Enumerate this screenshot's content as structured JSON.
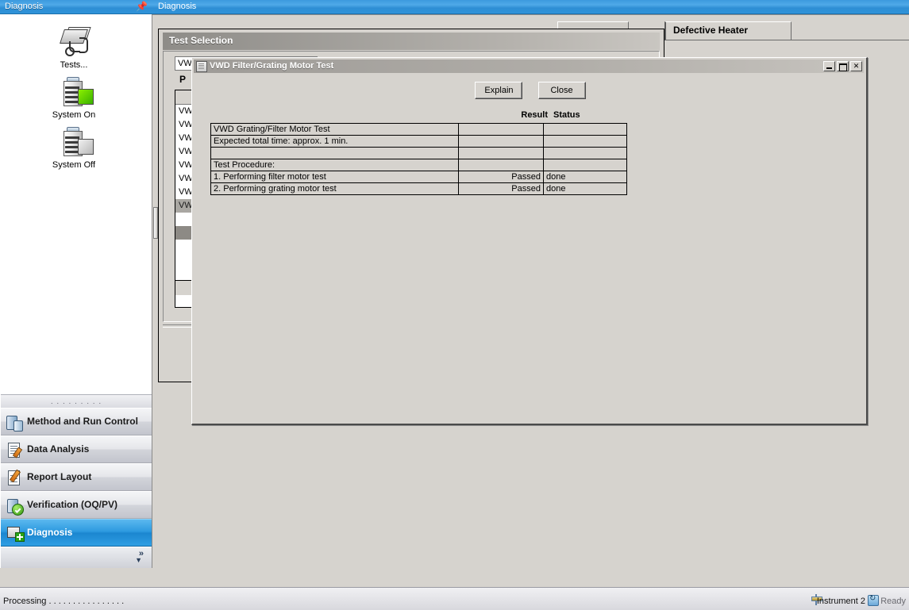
{
  "nav_panel": {
    "title": "Diagnosis",
    "pin_icon": "pin-icon",
    "icons": [
      {
        "label": "Tests...",
        "icon": "tests-instrument-icon"
      },
      {
        "label": "System On",
        "icon": "system-on-icon"
      },
      {
        "label": "System Off",
        "icon": "system-off-icon"
      }
    ],
    "dots": ". . . . . . . . .",
    "buttons": [
      {
        "label": "Method and Run Control",
        "icon": "method-run-control-icon",
        "selected": false
      },
      {
        "label": "Data Analysis",
        "icon": "data-analysis-icon",
        "selected": false
      },
      {
        "label": "Report Layout",
        "icon": "report-layout-icon",
        "selected": false
      },
      {
        "label": "Verification (OQ/PV)",
        "icon": "verification-icon",
        "selected": false
      },
      {
        "label": "Diagnosis",
        "icon": "diagnosis-icon",
        "selected": true
      }
    ],
    "expand_icon": "»",
    "expand_icon_2": "▼"
  },
  "workspace": {
    "title": "Diagnosis",
    "tabs": [
      {
        "label": "Defective Heater",
        "active": true
      },
      {
        "label": "",
        "active": false
      }
    ],
    "test_selection": {
      "caption": "Test Selection",
      "column_header": "VW",
      "p_label": "P",
      "list_items": [
        "",
        "VW",
        "VW",
        "VW",
        "VW",
        "VW",
        "VW",
        "VW",
        "VW",
        "",
        "",
        ""
      ]
    }
  },
  "dialog": {
    "title": "VWD Filter/Grating Motor Test",
    "sysicon": "window-system-icon",
    "minimize_icon": "minimize-icon",
    "maximize_icon": "maximize-icon",
    "close_icon": "close-icon",
    "close_glyph": "✕",
    "buttons": {
      "explain": "Explain",
      "close": "Close"
    },
    "table": {
      "headers": {
        "result": "Result",
        "status": "Status"
      },
      "rows": [
        {
          "desc": "VWD Grating/Filter Motor Test",
          "result": "",
          "status": ""
        },
        {
          "desc": "Expected total time: approx. 1 min.",
          "result": "",
          "status": ""
        },
        {
          "desc": "",
          "result": "",
          "status": ""
        },
        {
          "desc": "Test Procedure:",
          "result": "",
          "status": ""
        },
        {
          "desc": "1. Performing filter motor test",
          "result": "Passed",
          "status": "done"
        },
        {
          "desc": "2. Performing grating motor test",
          "result": "Passed",
          "status": "done"
        }
      ]
    }
  },
  "statusbar": {
    "processing": "Processing . . . . . . . . . . . . . . . .",
    "instrument_icon": "instrument-icon",
    "instrument": "Instrument 2",
    "ready_icon": "ready-refresh-icon",
    "ready": "Ready"
  },
  "colors": {
    "titlebar_blue": "#2e8ed4",
    "window_face": "#d6d3ce",
    "selected_nav": "#1b86d0",
    "dialog_caption": "#b0ada8"
  }
}
